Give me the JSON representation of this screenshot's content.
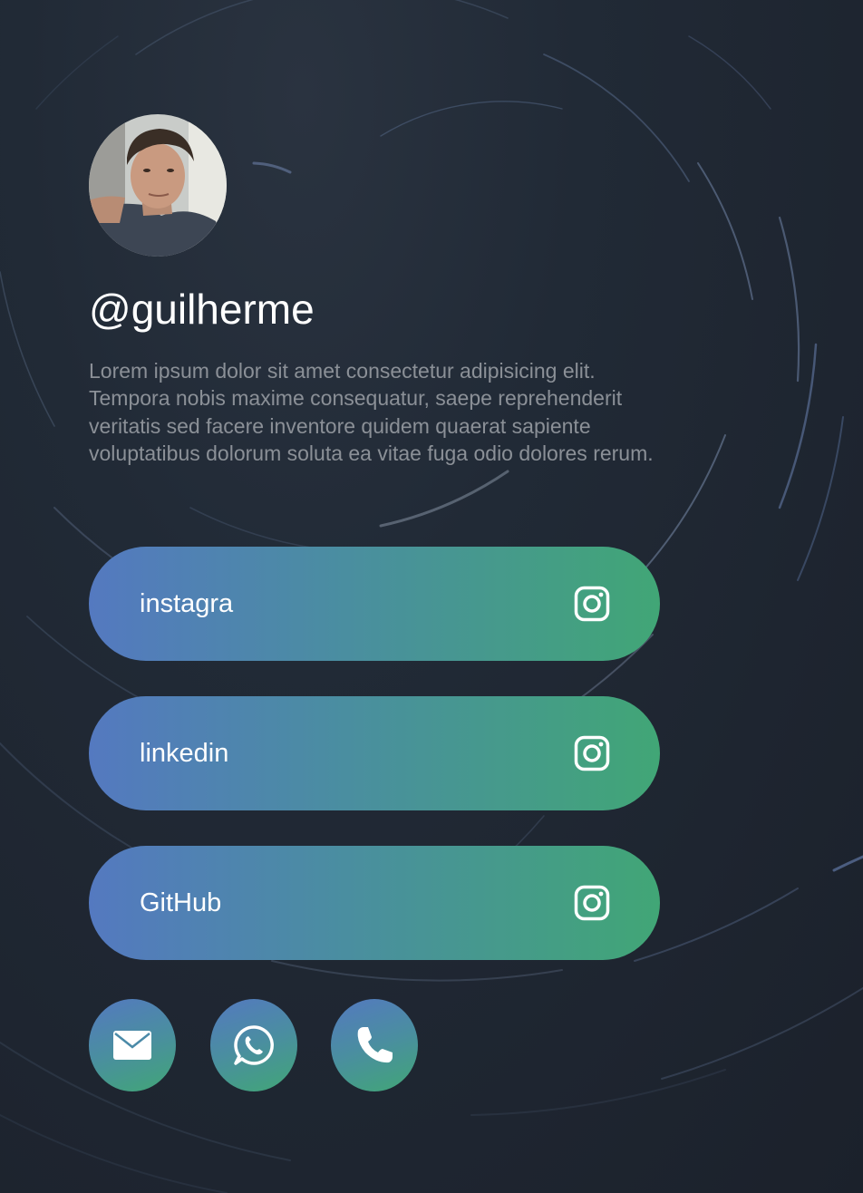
{
  "profile": {
    "handle": "@guilherme",
    "bio": "Lorem ipsum dolor sit amet consectetur adipisicing elit. Tempora nobis maxime consequatur, saepe reprehenderit veritatis sed facere inventore quidem quaerat sapiente voluptatibus dolorum soluta ea vitae fuga odio dolores rerum."
  },
  "links": [
    {
      "label": "instagra",
      "icon": "instagram-icon"
    },
    {
      "label": "linkedin",
      "icon": "instagram-icon"
    },
    {
      "label": "GitHub",
      "icon": "instagram-icon"
    }
  ],
  "contacts": [
    {
      "icon": "mail-icon"
    },
    {
      "icon": "whatsapp-icon"
    },
    {
      "icon": "phone-icon"
    }
  ],
  "colors": {
    "gradient_start": "#5479c0",
    "gradient_end": "#41a676",
    "background": "#1e2530",
    "bio_text": "#8b9097"
  }
}
